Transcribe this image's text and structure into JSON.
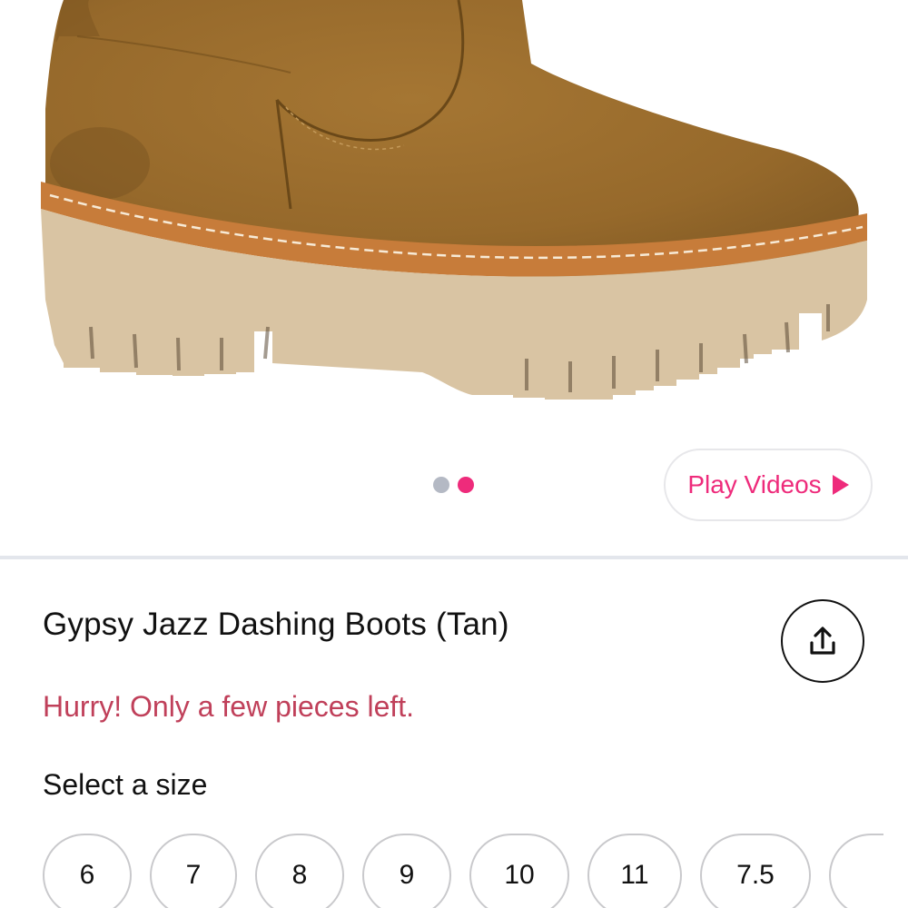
{
  "product": {
    "title": "Gypsy Jazz Dashing Boots (Tan)",
    "stock_message": "Hurry! Only a few pieces left.",
    "image_alt": "Tan suede ankle boot with lug sole"
  },
  "carousel": {
    "dots": [
      {
        "state": "inactive",
        "color": "#b4b9c4"
      },
      {
        "state": "active",
        "color": "#ee2b7b"
      }
    ]
  },
  "play_videos": {
    "label": "Play Videos",
    "icon": "play-icon"
  },
  "share": {
    "icon": "share-icon"
  },
  "size_selector": {
    "label": "Select a size",
    "options": [
      "6",
      "7",
      "8",
      "9",
      "10",
      "11",
      "7.5"
    ]
  },
  "colors": {
    "accent": "#ee2b7b",
    "stock_text": "#c0405a",
    "boot_suede": "#9c6e2e",
    "sole": "#d9c4a3"
  }
}
